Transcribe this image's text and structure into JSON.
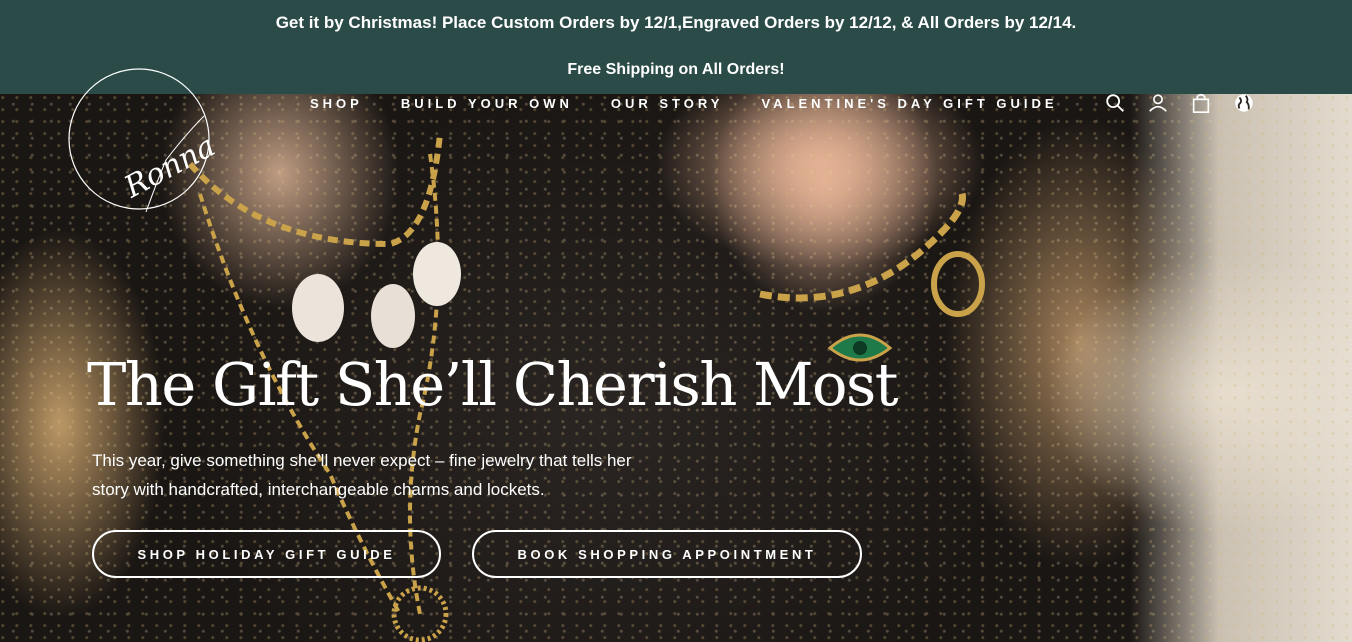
{
  "announcement": {
    "line1": "Get it by Christmas! Place Custom Orders by 12/1,Engraved Orders by 12/12, & All Orders by 12/14.",
    "line2": "Free Shipping on All Orders!"
  },
  "header": {
    "logo_text": "Ronna",
    "nav": [
      {
        "label": "SHOP"
      },
      {
        "label": "BUILD YOUR OWN"
      },
      {
        "label": "OUR STORY"
      },
      {
        "label": "VALENTINE'S DAY GIFT GUIDE"
      }
    ],
    "icons": [
      "search-icon",
      "account-icon",
      "cart-icon",
      "globe-icon"
    ]
  },
  "hero": {
    "title": "The Gift She’ll Cherish Most",
    "subtitle": "This year, give something she’ll never expect – fine jewelry that tells her story with handcrafted, interchangeable charms and lockets.",
    "buttons": {
      "gift_guide": "SHOP HOLIDAY GIFT GUIDE",
      "appointment": "BOOK SHOPPING APPOINTMENT"
    }
  },
  "colors": {
    "announcement_bg": "#2a4b48",
    "text_light": "#ffffff"
  }
}
